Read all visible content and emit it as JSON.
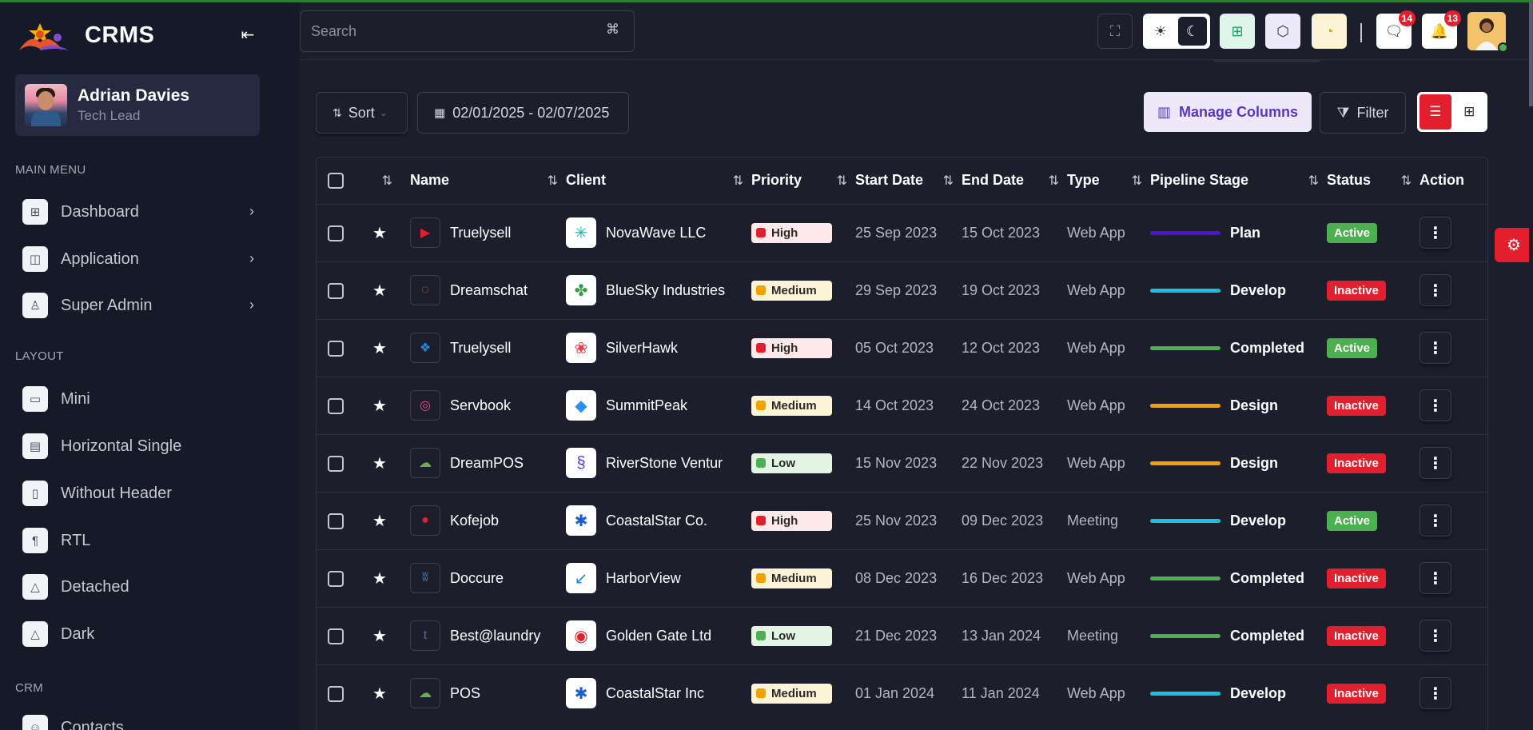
{
  "brand": {
    "name": "CRMS"
  },
  "user": {
    "name": "Adrian Davies",
    "role": "Tech Lead"
  },
  "sidebar": {
    "sections": [
      {
        "title": "MAIN MENU",
        "items": [
          {
            "label": "Dashboard",
            "icon": "dashboard-icon",
            "has_children": true
          },
          {
            "label": "Application",
            "icon": "application-icon",
            "has_children": true
          },
          {
            "label": "Super Admin",
            "icon": "user-star-icon",
            "has_children": true
          }
        ]
      },
      {
        "title": "LAYOUT",
        "items": [
          {
            "label": "Mini",
            "icon": "layout-mini-icon"
          },
          {
            "label": "Horizontal Single",
            "icon": "layout-horizontal-icon"
          },
          {
            "label": "Without Header",
            "icon": "layout-sidebar-icon"
          },
          {
            "label": "RTL",
            "icon": "rtl-icon"
          },
          {
            "label": "Detached",
            "icon": "triangle-icon"
          },
          {
            "label": "Dark",
            "icon": "triangle-icon"
          }
        ]
      },
      {
        "title": "CRM",
        "items": [
          {
            "label": "Contacts",
            "icon": "contacts-icon"
          }
        ]
      }
    ]
  },
  "header": {
    "search_placeholder": "Search",
    "search_shortcut": "⌘",
    "notifications_count": "14",
    "messages_count": "13"
  },
  "toolbar": {
    "sort_label": "Sort",
    "date_range": "02/01/2025 - 02/07/2025",
    "manage_columns_label": "Manage Columns",
    "filter_label": "Filter"
  },
  "table": {
    "columns": [
      "Name",
      "Client",
      "Priority",
      "Start Date",
      "End Date",
      "Type",
      "Pipeline Stage",
      "Status",
      "Action"
    ],
    "rows": [
      {
        "name": "Truelysell",
        "name_icon": "youtube-icon",
        "client": "NovaWave LLC",
        "client_icon": "nova-logo",
        "priority": "High",
        "start": "25 Sep 2023",
        "end": "15 Oct 2023",
        "type": "Web App",
        "stage": "Plan",
        "stage_color": "#4a17d6",
        "status": "Active"
      },
      {
        "name": "Dreamschat",
        "name_icon": "swirl-icon",
        "client": "BlueSky Industries",
        "client_icon": "bluesky-logo",
        "priority": "Medium",
        "start": "29 Sep 2023",
        "end": "19 Oct 2023",
        "type": "Web App",
        "stage": "Develop",
        "stage_color": "#1ec0e0",
        "status": "Inactive"
      },
      {
        "name": "Truelysell",
        "name_icon": "dropbox-icon",
        "client": "SilverHawk",
        "client_icon": "silverhawk-logo",
        "priority": "High",
        "start": "05 Oct 2023",
        "end": "12 Oct 2023",
        "type": "Web App",
        "stage": "Completed",
        "stage_color": "#4caf50",
        "status": "Active"
      },
      {
        "name": "Servbook",
        "name_icon": "dribbble-icon",
        "client": "SummitPeak",
        "client_icon": "summitpeak-logo",
        "priority": "Medium",
        "start": "14 Oct 2023",
        "end": "24 Oct 2023",
        "type": "Web App",
        "stage": "Design",
        "stage_color": "#f5a000",
        "status": "Inactive"
      },
      {
        "name": "DreamPOS",
        "name_icon": "wechat-icon",
        "client": "RiverStone Ventur",
        "client_icon": "riverstone-logo",
        "priority": "Low",
        "start": "15 Nov 2023",
        "end": "22 Nov 2023",
        "type": "Web App",
        "stage": "Design",
        "stage_color": "#f5a000",
        "status": "Inactive"
      },
      {
        "name": "Kofejob",
        "name_icon": "reddit-icon",
        "client": "CoastalStar Co.",
        "client_icon": "coastalstar-logo",
        "priority": "High",
        "start": "25 Nov 2023",
        "end": "09 Dec 2023",
        "type": "Meeting",
        "stage": "Develop",
        "stage_color": "#1ec0e0",
        "status": "Active"
      },
      {
        "name": "Doccure",
        "name_icon": "vk-icon",
        "client": "HarborView",
        "client_icon": "harborview-logo",
        "priority": "Medium",
        "start": "08 Dec 2023",
        "end": "16 Dec 2023",
        "type": "Web App",
        "stage": "Completed",
        "stage_color": "#4caf50",
        "status": "Inactive"
      },
      {
        "name": "Best@laundry",
        "name_icon": "tumblr-icon",
        "client": "Golden Gate Ltd",
        "client_icon": "goldengate-logo",
        "priority": "Low",
        "start": "21 Dec 2023",
        "end": "13 Jan 2024",
        "type": "Meeting",
        "stage": "Completed",
        "stage_color": "#4caf50",
        "status": "Inactive"
      },
      {
        "name": "POS",
        "name_icon": "wechat-icon",
        "client": "CoastalStar Inc",
        "client_icon": "coastalstar-logo",
        "priority": "Medium",
        "start": "01 Jan 2024",
        "end": "11 Jan 2024",
        "type": "Web App",
        "stage": "Develop",
        "stage_color": "#1ec0e0",
        "status": "Inactive"
      }
    ]
  },
  "colors": {
    "accent_red": "#e41f2d",
    "active_green": "#4caf50",
    "purple": "#5b35c9",
    "background": "#1c1e2c"
  }
}
